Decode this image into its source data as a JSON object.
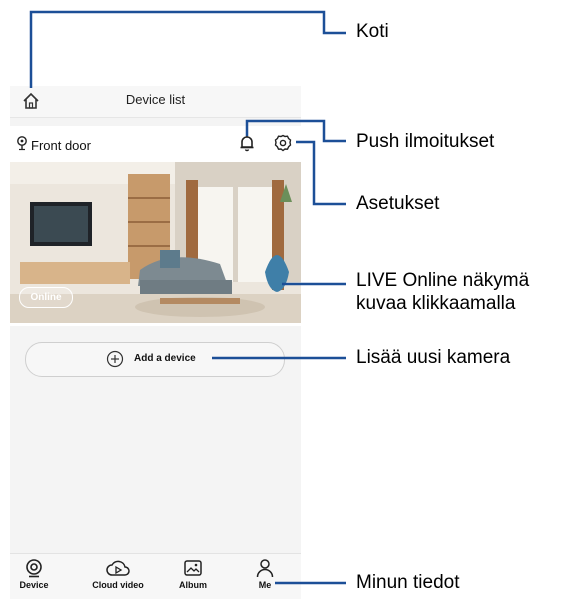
{
  "app": {
    "title": "Device list",
    "device": {
      "name": "Front door",
      "status": "Online"
    },
    "add_device_label": "Add a device",
    "nav": [
      {
        "label": "Device",
        "icon": "device-icon"
      },
      {
        "label": "Cloud video",
        "icon": "cloud-video-icon"
      },
      {
        "label": "Album",
        "icon": "album-icon"
      },
      {
        "label": "Me",
        "icon": "me-icon"
      }
    ],
    "icons": {
      "home": "home-icon",
      "bell": "bell-icon",
      "gear": "gear-icon",
      "add": "plus-circle-icon",
      "location": "location-pin-icon"
    }
  },
  "callouts": {
    "home": "Koti",
    "push": "Push ilmoitukset",
    "settings": "Asetukset",
    "live_line1": "LIVE Online näkymä",
    "live_line2": "kuvaa klikkaamalla",
    "add_camera": "Lisää uusi kamera",
    "my_info": "Minun tiedot"
  },
  "colors": {
    "callout_line": "#1c4f97",
    "background": "#f4f4f4",
    "accent": "#111111"
  }
}
